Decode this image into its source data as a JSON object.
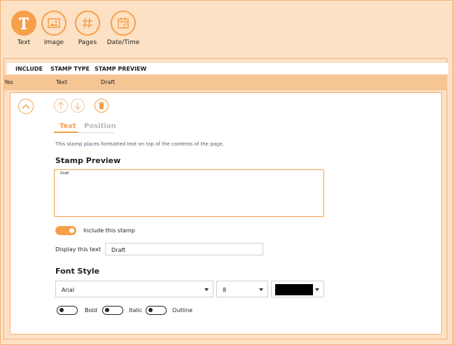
{
  "toolbar": {
    "items": [
      {
        "label": "Text",
        "icon": "text-icon"
      },
      {
        "label": "Image",
        "icon": "image-icon"
      },
      {
        "label": "Pages",
        "icon": "hash-icon"
      },
      {
        "label": "Date/Time",
        "icon": "calendar-icon"
      }
    ]
  },
  "table": {
    "headers": [
      "INCLUDE",
      "STAMP TYPE",
      "STAMP PREVIEW"
    ],
    "rows": [
      {
        "include": "Yes",
        "type": "Text",
        "preview": "Draft"
      }
    ]
  },
  "editor": {
    "tabs": [
      {
        "label": "Text",
        "active": true
      },
      {
        "label": "Position",
        "active": false
      }
    ],
    "description": "This stamp places formatted text on top of the contents of the page.",
    "preview_title": "Stamp Preview",
    "preview_text": "Draft",
    "include_label": "Include this stamp",
    "include_on": true,
    "display_label": "Display this text",
    "display_value": "Draft",
    "font_style_title": "Font Style",
    "font_family": "Arial",
    "font_size": "8",
    "font_color": "#000000",
    "bold_label": "Bold",
    "italic_label": "Italic",
    "outline_label": "Outline"
  },
  "colors": {
    "accent": "#f6a04a",
    "background": "#fde1c4",
    "selected_row": "#f6c594"
  }
}
